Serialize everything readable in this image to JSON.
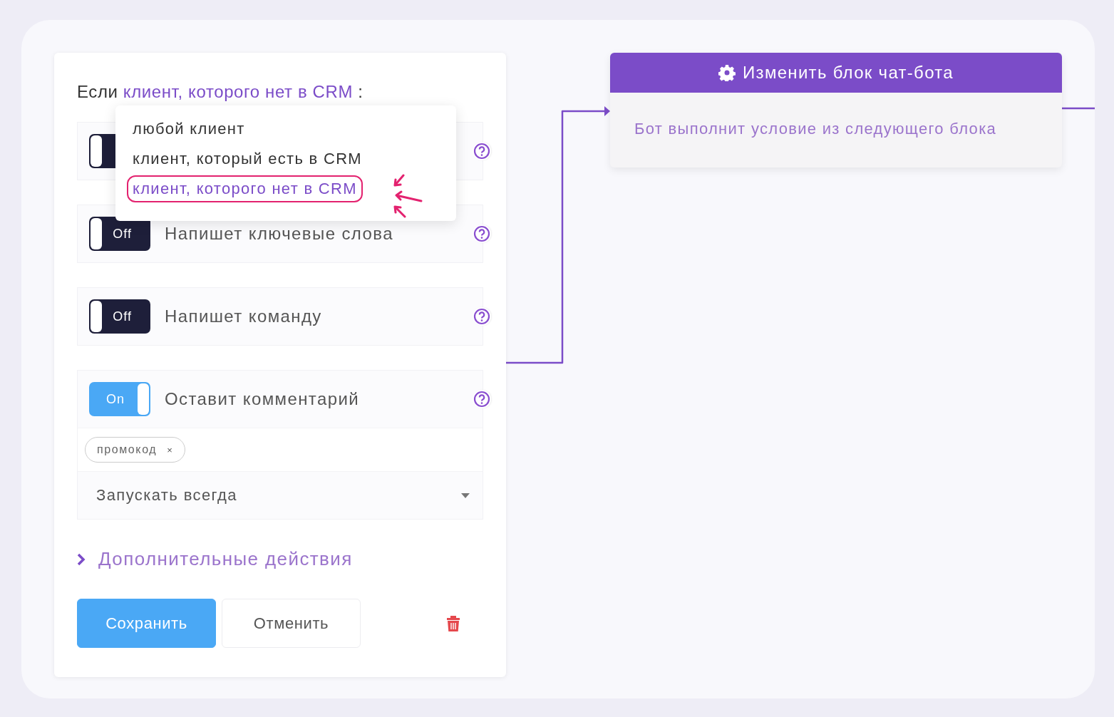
{
  "condition": {
    "prefix": "Если",
    "value": "клиент, которого нет в CRM",
    "suffix": ":"
  },
  "dropdown": {
    "items": [
      {
        "label": "любой клиент",
        "selected": false
      },
      {
        "label": "клиент, который есть в CRM",
        "selected": false
      },
      {
        "label": "клиент, которого нет в CRM",
        "selected": true
      }
    ]
  },
  "triggers": [
    {
      "on": false
    },
    {
      "label": "Напишет ключевые слова",
      "toggle": "Off",
      "on": false
    },
    {
      "label": "Напишет команду",
      "toggle": "Off",
      "on": false
    },
    {
      "label": "Оставит комментарий",
      "toggle": "On",
      "on": true,
      "tags": [
        {
          "label": "промокод",
          "remove": "×"
        }
      ],
      "select": {
        "value": "Запускать всегда"
      }
    }
  ],
  "more_actions": {
    "label": "Дополнительные действия",
    "expanded": false
  },
  "buttons": {
    "save": "Сохранить",
    "cancel": "Отменить"
  },
  "node": {
    "title": "Изменить блок чат-бота",
    "body": "Бот выполнит условие из следующего блока"
  }
}
